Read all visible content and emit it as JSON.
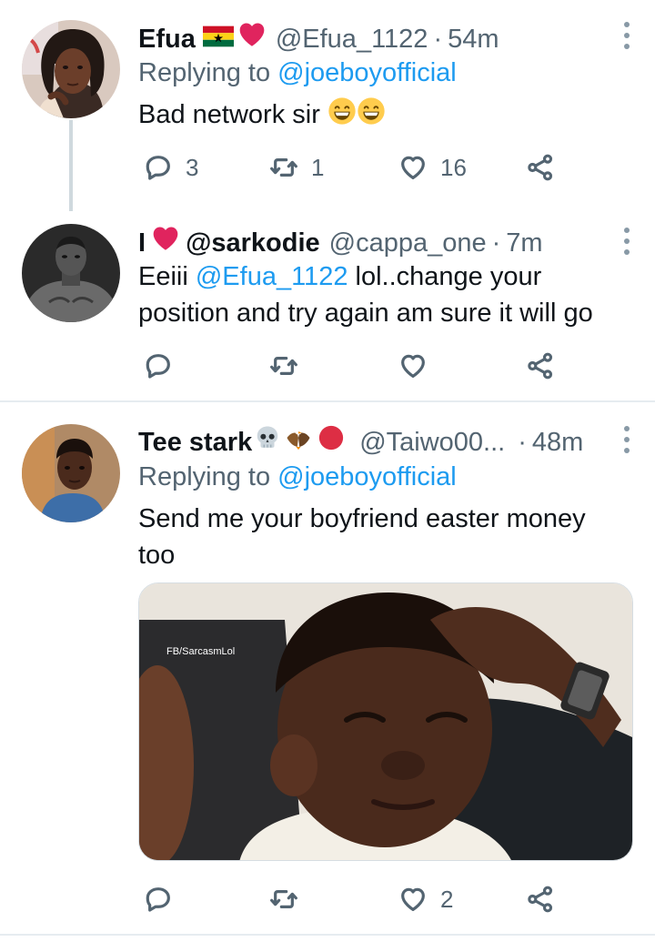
{
  "tweets": [
    {
      "name": "Efua",
      "name_emoji": [
        "ghana-flag",
        "red-heart"
      ],
      "handle": "@Efua_1122",
      "separator": "·",
      "time": "54m",
      "reply_prefix": "Replying to ",
      "reply_to": "@joeboyofficial",
      "text": "Bad network sir",
      "text_emoji": [
        "grinning-face",
        "grinning-face"
      ],
      "replies": "3",
      "retweets": "1",
      "likes": "16"
    },
    {
      "name_prefix": "I",
      "name": "@sarkodie",
      "name_emoji": [
        "red-heart"
      ],
      "handle": "@cappa_one",
      "separator": "·",
      "time": "7m",
      "text_prefix": "Eeiii ",
      "mention": "@Efua_1122",
      "text": " lol..change your position and try again am sure it will go",
      "replies": "",
      "retweets": "",
      "likes": ""
    },
    {
      "name": "Tee stark",
      "name_emoji": [
        "skull",
        "eagle",
        "red-circle"
      ],
      "handle": "@Taiwo00...",
      "separator": "·",
      "time": "48m",
      "reply_prefix": "Replying to ",
      "reply_to": "@joeboyofficial",
      "text": "Send me your boyfriend easter money too",
      "media_watermark": "FB/SarcasmLol",
      "replies": "",
      "retweets": "",
      "likes": "2"
    }
  ],
  "colors": {
    "link": "#1d9bf0",
    "secondary_text": "#536471",
    "heart_red": "#e0245e",
    "divider": "#e6ecf0"
  },
  "icons": [
    "reply-icon",
    "retweet-icon",
    "like-icon",
    "share-icon",
    "more-options-icon"
  ]
}
